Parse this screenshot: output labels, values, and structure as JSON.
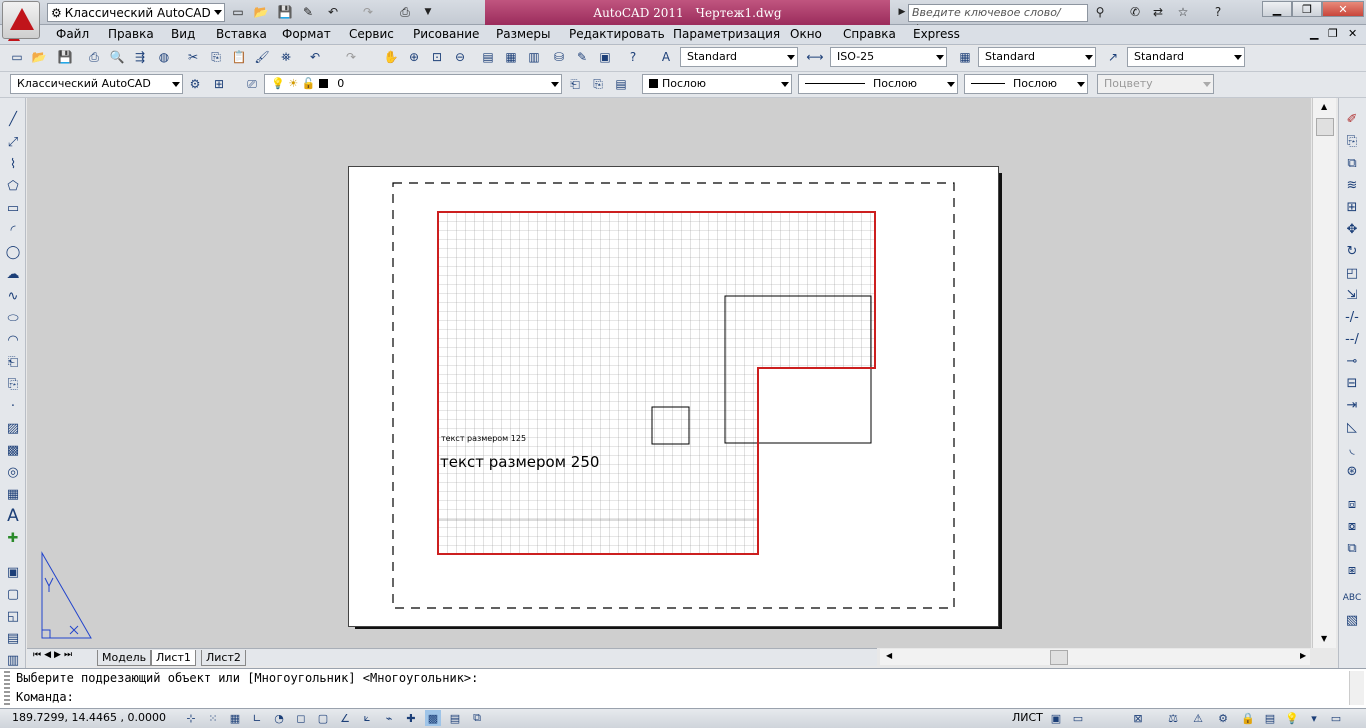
{
  "titlebar": {
    "workspace": "Классический AutoCAD",
    "app_name": "AutoCAD 2011",
    "file_name": "Чертеж1.dwg",
    "search_placeholder": "Введите ключевое слово/фразу"
  },
  "menu": [
    "Файл",
    "Правка",
    "Вид",
    "Вставка",
    "Формат",
    "Сервис",
    "Рисование",
    "Размеры",
    "Редактировать",
    "Параметризация",
    "Окно",
    "Справка",
    "Express"
  ],
  "styles_toolbar": {
    "text_style": "Standard",
    "dim_style": "ISO-25",
    "table_style": "Standard",
    "mleader_style": "Standard"
  },
  "layers_toolbar": {
    "workspace": "Классический AutoCAD",
    "layer": "0",
    "color": "Послою",
    "linetype": "Послою",
    "lineweight": "Послою",
    "plotstyle": "Поцвету"
  },
  "drawing": {
    "text_small": "текст размером 125",
    "text_large": "текст размером 250",
    "boundary_color": "#cc1f1f"
  },
  "tabs": [
    "Модель",
    "Лист1",
    "Лист2"
  ],
  "active_tab": "Лист1",
  "command": {
    "history": "Выберите подрезающий объект или [Многоугольник] <Многоугольник>:",
    "prompt": "Команда:"
  },
  "status": {
    "coords": "189.7299, 14.4465 , 0.0000",
    "space": "ЛИСТ"
  },
  "icons": {
    "new": "new-file-icon",
    "open": "open-folder-icon",
    "save": "save-icon",
    "undo": "undo-icon",
    "redo": "redo-icon",
    "plot": "print-icon"
  }
}
